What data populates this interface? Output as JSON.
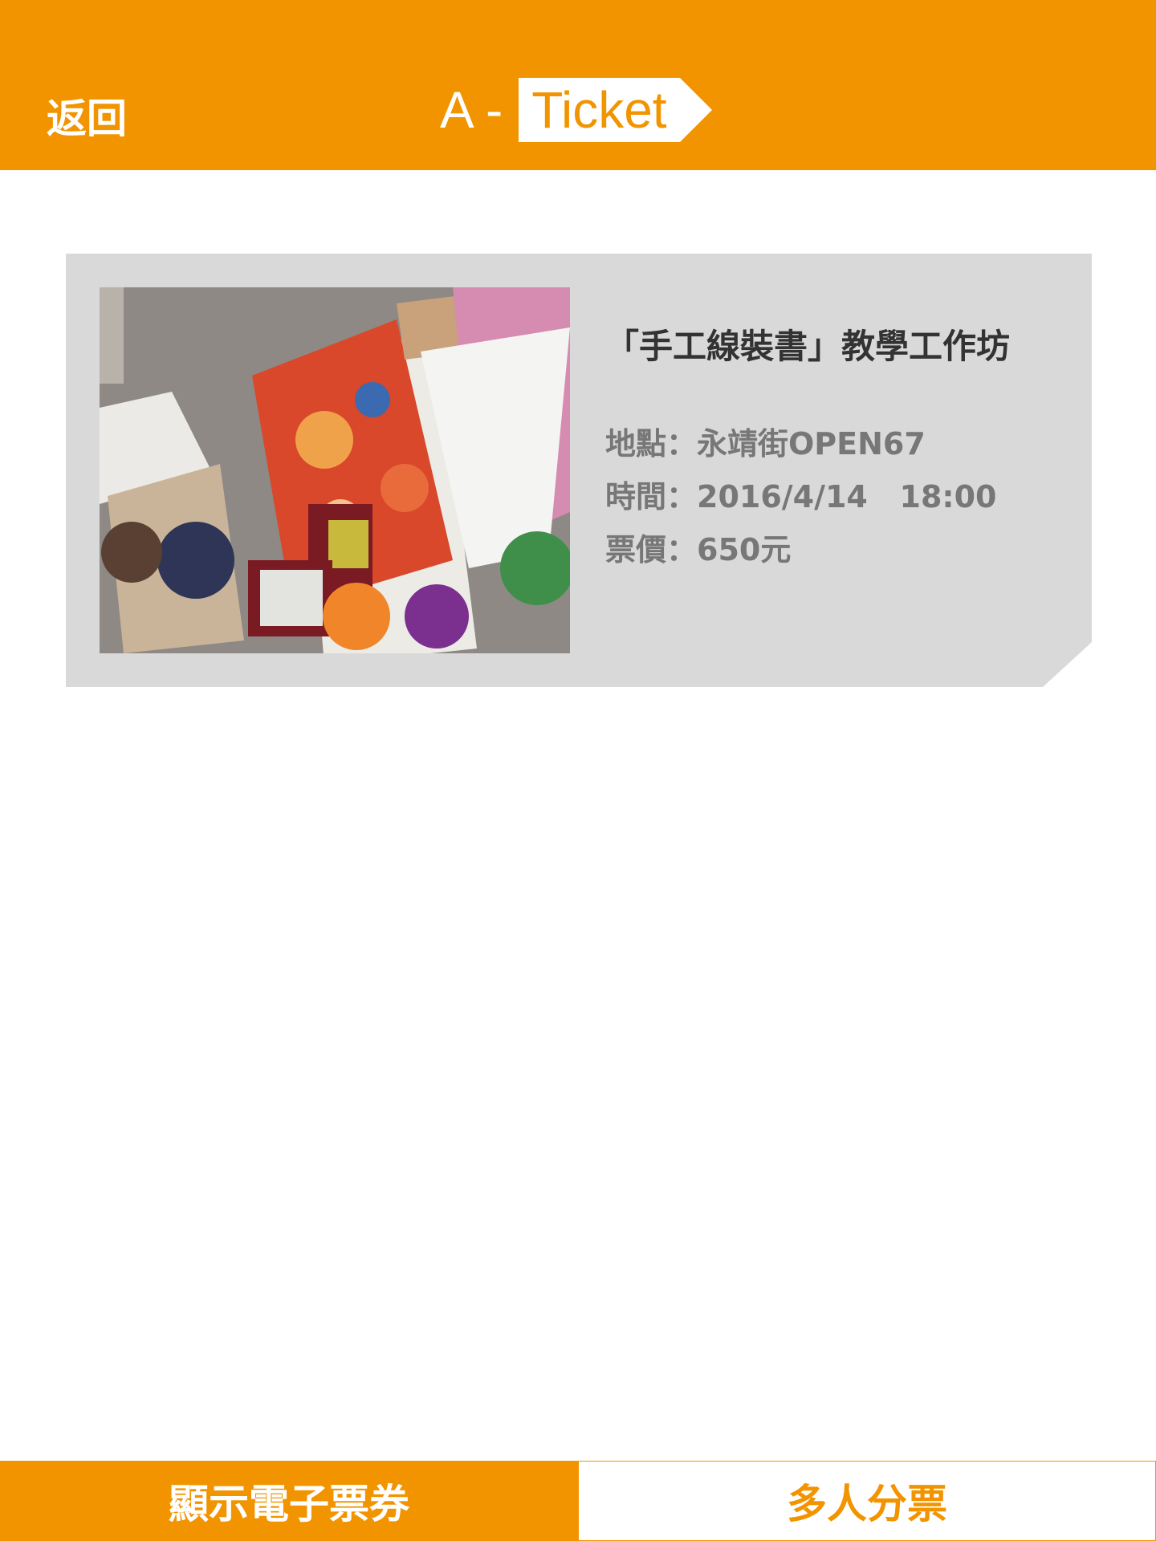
{
  "header": {
    "back_label": "返回",
    "logo_prefix": "A -",
    "logo_tag": "Ticket"
  },
  "event": {
    "title": "「手工線裝書」教學工作坊",
    "location": "地點：永靖街OPEN67",
    "time": "時間：2016/4/14   18:00",
    "price": "票價：650元"
  },
  "footer": {
    "show_ticket_label": "顯示電子票券",
    "share_ticket_label": "多人分票"
  },
  "colors": {
    "brand": "#F29400",
    "card_bg": "#D9D9DA",
    "title_text": "#333333",
    "info_text": "#777777"
  }
}
